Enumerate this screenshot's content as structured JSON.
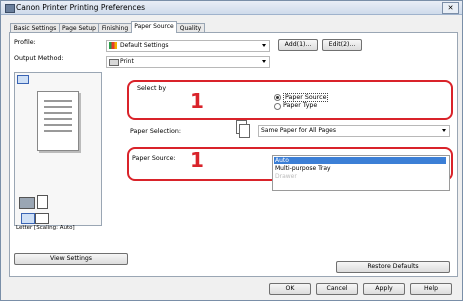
{
  "window": {
    "title": "Canon Printer Printing Preferences",
    "close_glyph": "✕"
  },
  "tabs": [
    "Basic Settings",
    "Page Setup",
    "Finishing",
    "Paper Source",
    "Quality"
  ],
  "profile": {
    "label": "Profile:",
    "value": "Default Settings",
    "add_button": "Add(1)...",
    "edit_button": "Edit(2)..."
  },
  "output_method": {
    "label": "Output Method:",
    "value": "Print"
  },
  "preview": {
    "caption": "Letter [Scaling: Auto]",
    "view_settings_button": "View Settings"
  },
  "select_by": {
    "label": "Select by",
    "callout_number": "1",
    "options": [
      {
        "label": "Paper Source",
        "selected": true
      },
      {
        "label": "Paper Type",
        "selected": false
      }
    ]
  },
  "paper_selection": {
    "label": "Paper Selection:",
    "value": "Same Paper for All Pages"
  },
  "paper_source": {
    "label": "Paper Source:",
    "callout_number": "1",
    "options": [
      {
        "label": "Auto",
        "selected": true
      },
      {
        "label": "Multi-purpose Tray",
        "selected": false
      },
      {
        "label": "Drawer",
        "selected": false
      }
    ]
  },
  "restore_defaults_button": "Restore Defaults",
  "footer": {
    "ok": "OK",
    "cancel": "Cancel",
    "apply": "Apply",
    "help": "Help"
  },
  "colors": {
    "callout_red": "#d9232a",
    "selection_blue": "#3c7fd6"
  }
}
